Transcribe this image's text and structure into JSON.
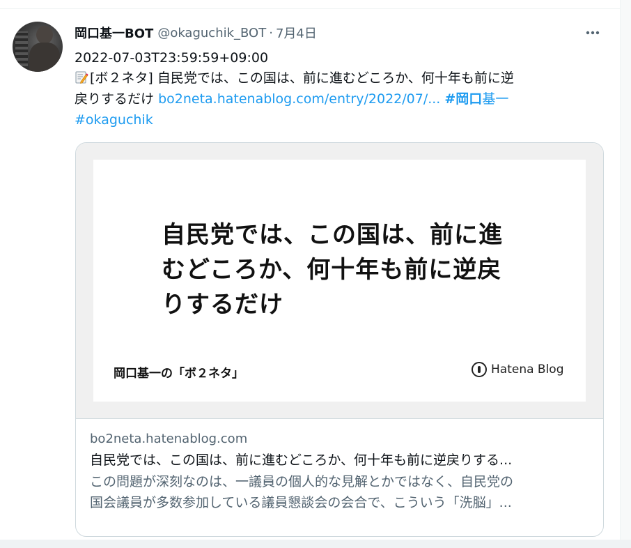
{
  "tweet": {
    "display_name": "岡口基一BOT",
    "handle": "@okaguchik_BOT",
    "separator": "·",
    "date": "7月4日",
    "more_icon": "more-horizontal-icon",
    "text": {
      "timestamp": "2022-07-03T23:59:59+09:00",
      "memo_icon": "memo-icon",
      "body_prefix": "[ボ２ネタ] 自民党では、この国は、前に進むどころか、何十年も前に逆",
      "body_line2": "戻りするだけ",
      "link": "bo2neta.hatenablog.com/entry/2022/07/...",
      "hashtag1_bold": "#岡口",
      "hashtag1_rest": "基一",
      "hashtag2": "#okaguchik"
    }
  },
  "card": {
    "image": {
      "title_line1": "自民党では、この国は、前に進",
      "title_line2": "むどころか、何十年も前に逆戻",
      "title_line3": "りするだけ",
      "blog_name": "岡口基一の「ボ２ネタ」",
      "brand": "Hatena Blog",
      "brand_icon": "hatena-blog-logo-icon"
    },
    "domain": "bo2neta.hatenablog.com",
    "title": "自民党では、この国は、前に進むどころか、何十年も前に逆戻りする...",
    "description_line1": "この問題が深刻なのは、一議員の個人的な見解とかではなく、自民党の",
    "description_line2": "国会議員が多数参加している議員懇談会の会合で、こういう「洗脳」..."
  },
  "colors": {
    "link": "#1d9bf0",
    "secondary_text": "#536471",
    "primary_text": "#0f1419",
    "border": "#cfd9de"
  }
}
